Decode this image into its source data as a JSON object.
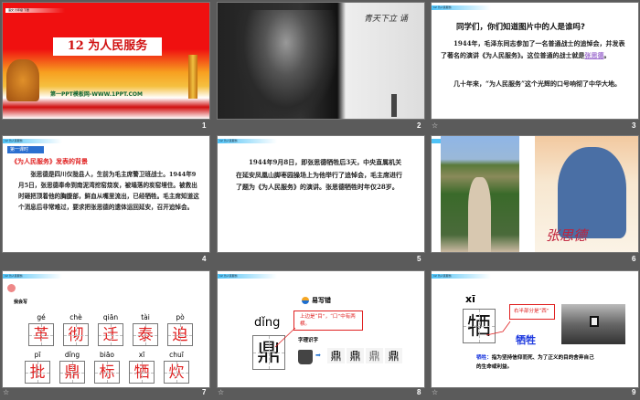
{
  "header_tag": "12 为人民服务",
  "slides": [
    {
      "num": "1",
      "title": "12 为人民服务",
      "subtitle": "第一PPT模板网-WWW.1PPT.COM",
      "topbar": "语文 六年级 下册"
    },
    {
      "num": "2",
      "calligraphy": "青天下立 诵"
    },
    {
      "num": "3",
      "question": "同学们，你们知道图片中的人是谁吗?",
      "p1": "1944年，毛泽东同志参加了一名普通战士的追悼会，并发表了著名的演讲《为人民服务》。这位普通的战士就是",
      "link": "张思德",
      "p1_end": "。",
      "p2": "几十年来，“为人民服务”这个光辉的口号响彻了中华大地。"
    },
    {
      "num": "4",
      "badge": "第一课时",
      "heading": "《为人民服务》发表的背景",
      "body": "张思德是四川仪陇县人，生前为毛主席警卫班战士。1944年9月5日，张思德奉命到南泥湾挖窑烧炭，被塌落的炭窑埋住。被救出时砸把顶着他的胸腹部，鲜血从嘴里流出，已经牺牲。毛主席知道这个消息后非常难过，要求把张思德的遗体运回延安，召开追悼会。"
    },
    {
      "num": "5",
      "body": "1944年9月8日，即张思德牺牲后3天，中央直属机关在延安凤凰山脚枣园操场上为他举行了追悼会，毛主席进行了题为《为人民服务》的演讲。张思德牺牲时年仅28岁。"
    },
    {
      "num": "6",
      "poster_name": "张思德"
    },
    {
      "num": "7",
      "label": "我会写",
      "chars": [
        {
          "py": "gé",
          "ch": "革"
        },
        {
          "py": "chè",
          "ch": "彻"
        },
        {
          "py": "qiān",
          "ch": "迁"
        },
        {
          "py": "tài",
          "ch": "泰"
        },
        {
          "py": "pò",
          "ch": "迫"
        },
        {
          "py": "pī",
          "ch": "批"
        },
        {
          "py": "dǐng",
          "ch": "鼎"
        },
        {
          "py": "biāo",
          "ch": "标"
        },
        {
          "py": "xī",
          "ch": "牺"
        },
        {
          "py": "chuī",
          "ch": "炊"
        }
      ]
    },
    {
      "num": "8",
      "title": "易写错",
      "pinyin": "dǐng",
      "char": "鼎",
      "note": "上边是“目”，“口”中有两横。",
      "sub": "字理识字",
      "arrow": "➡",
      "evo": [
        "鼎",
        "鼎",
        "鼎",
        "鼎"
      ]
    },
    {
      "num": "9",
      "pinyin": "xī",
      "char": "牺",
      "note": "右半部分是“西”",
      "word": "牺牲",
      "def_label": "牺牲：",
      "def": "指为坚持信仰而死、为了正义的目的舍弃自己的生命或利益。"
    }
  ],
  "star_icon": "☆"
}
